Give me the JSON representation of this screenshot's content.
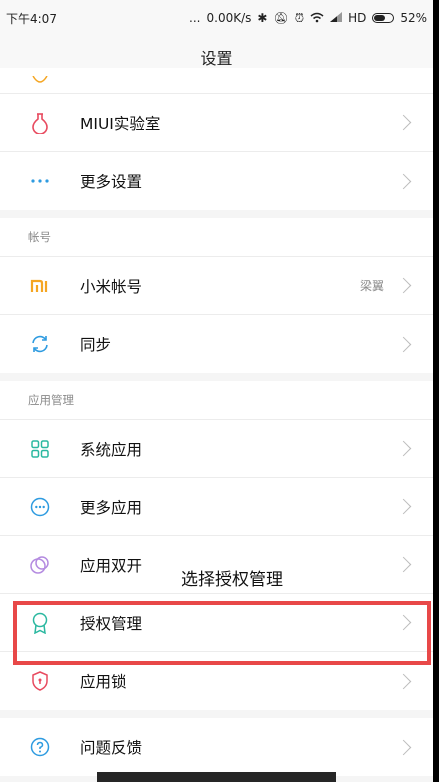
{
  "status_bar": {
    "time": "下午4:07",
    "signal_dots": "...",
    "network_speed": "0.00K/s",
    "hd": "HD",
    "battery": "52%"
  },
  "title": "设置",
  "sections": {
    "top": {
      "items": [
        {
          "label": "MIUI实验室",
          "icon": "flask-icon"
        },
        {
          "label": "更多设置",
          "icon": "more-dots-icon"
        }
      ]
    },
    "account": {
      "title": "帐号",
      "items": [
        {
          "label": "小米帐号",
          "value": "梁翼",
          "icon": "mi-logo-icon"
        },
        {
          "label": "同步",
          "icon": "sync-icon"
        }
      ]
    },
    "apps": {
      "title": "应用管理",
      "items": [
        {
          "label": "系统应用",
          "icon": "grid-icon"
        },
        {
          "label": "更多应用",
          "icon": "more-apps-icon"
        },
        {
          "label": "应用双开",
          "icon": "dual-apps-icon"
        },
        {
          "label": "授权管理",
          "icon": "authorization-icon"
        },
        {
          "label": "应用锁",
          "icon": "app-lock-icon"
        }
      ]
    },
    "help": {
      "items": [
        {
          "label": "问题反馈",
          "icon": "help-icon"
        }
      ]
    }
  },
  "annotation": "选择授权管理",
  "colors": {
    "highlight": "#e84848",
    "mi_orange": "#f5a623",
    "teal": "#2bb8a0",
    "blue": "#2e9be0"
  }
}
